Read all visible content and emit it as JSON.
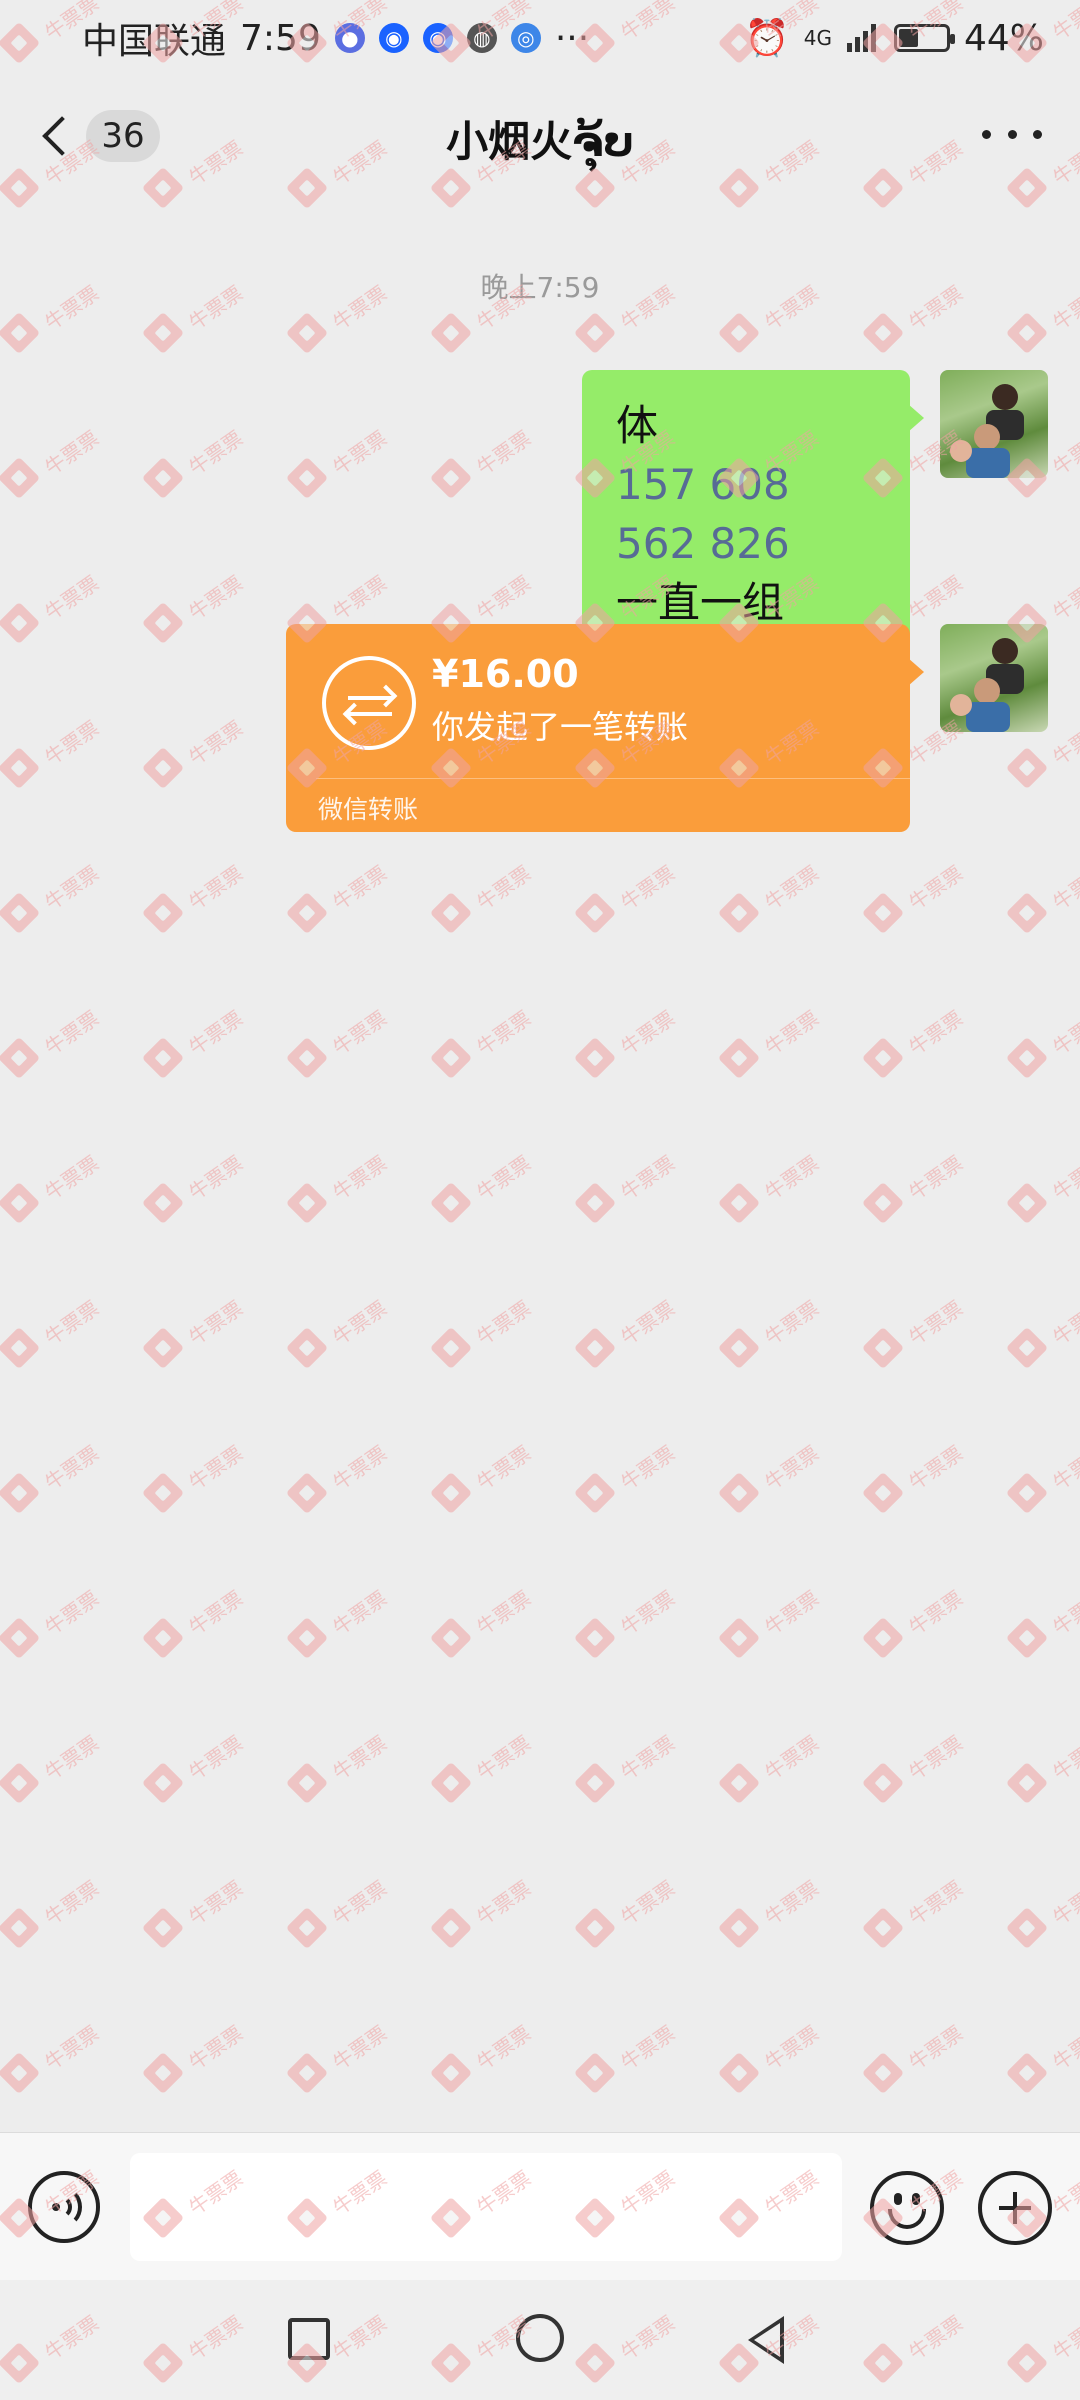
{
  "status_bar": {
    "carrier": "中国联通",
    "time": "7:59",
    "overflow": "···",
    "network": "4G",
    "battery_percent": "44%",
    "battery_level": 0.44
  },
  "header": {
    "unread_count": "36",
    "title": "小烟火ຈຸ້ບ"
  },
  "messages": {
    "timestamp": "晚上7:59",
    "text_message": {
      "line1": "体",
      "phone": "157 608 562 826",
      "line3": "一直一组"
    },
    "transfer": {
      "amount": "¥16.00",
      "description": "你发起了一笔转账",
      "footer": "微信转账"
    }
  },
  "watermark": {
    "text": "牛票票"
  },
  "input_bar": {
    "placeholder": ""
  },
  "colors": {
    "chat_bg": "#ededed",
    "sent_bubble": "#95ec69",
    "transfer_card": "#fa9d3b",
    "link": "#576b95",
    "watermark": "#f0a3a3"
  },
  "icons": {
    "back": "chevron-left-icon",
    "more": "more-horizontal-icon",
    "transfer": "transfer-arrows-icon",
    "voice": "voice-icon",
    "emoji": "smile-icon",
    "plus": "plus-circle-icon"
  }
}
